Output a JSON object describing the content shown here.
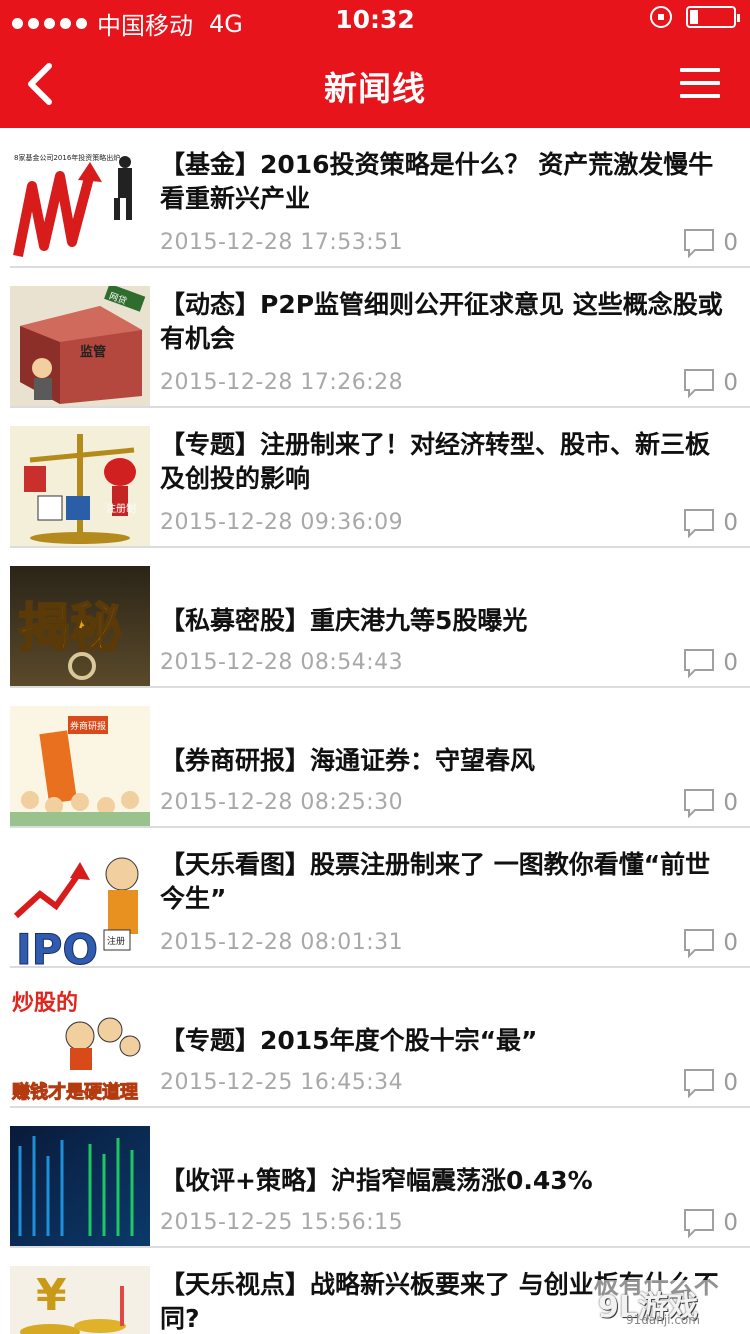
{
  "status_bar": {
    "carrier": "中国移动",
    "network": "4G",
    "time": "10:32"
  },
  "nav": {
    "title": "新闻线",
    "back_icon": "chevron-left-icon",
    "menu_icon": "hamburger-menu-icon"
  },
  "colors": {
    "brand": "#e8141b",
    "date": "#a8a8a8",
    "separator": "#dcdcdc"
  },
  "news": [
    {
      "title": "【基金】2016投资策略是什么？ 资产荒激发慢牛 看重新兴产业",
      "date": "2015-12-28 17:53:51",
      "comments": "0"
    },
    {
      "title": "【动态】P2P监管细则公开征求意见   这些概念股或有机会",
      "date": "2015-12-28 17:26:28",
      "comments": "0"
    },
    {
      "title": "【专题】注册制来了！对经济转型、股市、新三板及创投的影响",
      "date": "2015-12-28 09:36:09",
      "comments": "0"
    },
    {
      "title": "【私募密股】重庆港九等5股曝光",
      "date": "2015-12-28 08:54:43",
      "comments": "0"
    },
    {
      "title": "【券商研报】海通证券：守望春风",
      "date": "2015-12-28 08:25:30",
      "comments": "0"
    },
    {
      "title": "【天乐看图】股票注册制来了  一图教你看懂“前世今生”",
      "date": "2015-12-28 08:01:31",
      "comments": "0"
    },
    {
      "title": "【专题】2015年度个股十宗“最”",
      "date": "2015-12-25 16:45:34",
      "comments": "0"
    },
    {
      "title": "【收评+策略】沪指窄幅震荡涨0.43%",
      "date": "2015-12-25 15:56:15",
      "comments": "0"
    },
    {
      "title": "【天乐视点】战略新兴板要来了 与创业板有什么不同?",
      "date": "",
      "comments": ""
    }
  ],
  "thumbs": {
    "t0": "8家基金公司2016年投资策略出炉",
    "t1a": "监管",
    "t1b": "网贷",
    "t2": "注册制",
    "t3": "揭秘",
    "t4": "券商研报",
    "t5a": "IPO",
    "t5b": "注册",
    "t6a": "炒股的",
    "t6b": "赚钱才是硬道理"
  },
  "watermark": {
    "logo": "9L游戏",
    "site": "91danji.com"
  }
}
